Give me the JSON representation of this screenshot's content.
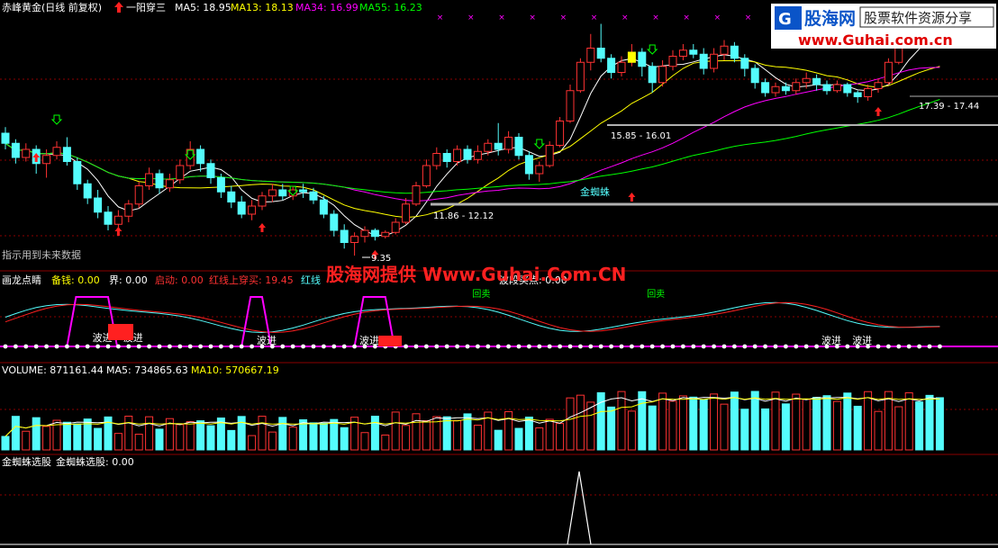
{
  "colors": {
    "background": "#000000",
    "up": "#ff3232",
    "down": "#54fcfc",
    "ma5": "#ffffff",
    "ma13": "#ffff00",
    "ma34": "#ff00ff",
    "ma55": "#00ff00",
    "grid": "#8b0000",
    "logo_blue": "#0a54c8",
    "logo_red": "#e00000",
    "watermark": "#ff2020"
  },
  "header": {
    "stock_name": "赤峰黄金(日线 前复权)",
    "pattern_name": "一阳穿三",
    "ma5_label": "MA5: 18.95",
    "ma13_label": "MA13: 18.13",
    "ma34_label": "MA34: 16.99",
    "ma55_label": "MA55: 16.23"
  },
  "logo": {
    "brand": "股海网",
    "slogan": "股票软件资源分享",
    "url": "www.Guhai.com.cn"
  },
  "main_notes": {
    "future_data_note": "指示用到未来数据",
    "low_label": "9.35",
    "range1": "11.86 - 12.12",
    "range2": "15.85 - 16.01",
    "range3": "17.39 - 17.44",
    "golden_spider": "金蜘蛛"
  },
  "panel2": {
    "title": "画龙点睛",
    "fields": [
      {
        "label": "备钱: 0.00",
        "color": "#ffff00"
      },
      {
        "label": "界: 0.00",
        "color": "#ffffff"
      },
      {
        "label": "启动: 0.00",
        "color": "#ff3232"
      },
      {
        "label": "红线上穿买: 19.45",
        "color": "#ff3232"
      },
      {
        "label": "红线",
        "color": "#54fcfc"
      }
    ],
    "trailing": "波段买点: 0.00",
    "watermark": "股海网提供 Www.Guhai.Com.CN",
    "signal_label": "波进",
    "top_label": "回卖"
  },
  "panel3": {
    "volume_label": "VOLUME: 871161.44",
    "ma5_label": "MA5: 734865.63",
    "ma10_label": "MA10: 570667.19"
  },
  "panel4": {
    "title": "金蜘蛛选股",
    "value_label": "金蜘蛛选股: 0.00"
  },
  "chart_data": {
    "type": "candlestick",
    "price_range": [
      9,
      21
    ],
    "candles": [
      {
        "o": 15.4,
        "c": 14.9,
        "h": 15.7,
        "l": 14.6
      },
      {
        "o": 14.9,
        "c": 14.2,
        "h": 15.1,
        "l": 13.9
      },
      {
        "o": 14.2,
        "c": 14.6,
        "h": 14.9,
        "l": 14.0
      },
      {
        "o": 14.6,
        "c": 13.9,
        "h": 14.8,
        "l": 13.4
      },
      {
        "o": 13.9,
        "c": 14.3,
        "h": 14.6,
        "l": 13.2
      },
      {
        "o": 14.3,
        "c": 14.7,
        "h": 15.0,
        "l": 14.1
      },
      {
        "o": 14.7,
        "c": 14.0,
        "h": 15.2,
        "l": 13.8
      },
      {
        "o": 14.0,
        "c": 12.9,
        "h": 14.2,
        "l": 12.6
      },
      {
        "o": 12.9,
        "c": 12.2,
        "h": 13.1,
        "l": 11.9
      },
      {
        "o": 12.2,
        "c": 11.5,
        "h": 12.6,
        "l": 11.2
      },
      {
        "o": 11.5,
        "c": 10.9,
        "h": 11.8,
        "l": 10.6
      },
      {
        "o": 10.9,
        "c": 11.3,
        "h": 11.6,
        "l": 10.6
      },
      {
        "o": 11.3,
        "c": 11.9,
        "h": 12.1,
        "l": 11.0
      },
      {
        "o": 11.9,
        "c": 12.8,
        "h": 13.0,
        "l": 11.7
      },
      {
        "o": 12.8,
        "c": 13.4,
        "h": 13.7,
        "l": 12.6
      },
      {
        "o": 13.4,
        "c": 12.7,
        "h": 13.6,
        "l": 12.4
      },
      {
        "o": 12.7,
        "c": 13.1,
        "h": 13.4,
        "l": 12.5
      },
      {
        "o": 13.1,
        "c": 13.8,
        "h": 14.1,
        "l": 12.9
      },
      {
        "o": 13.8,
        "c": 14.6,
        "h": 15.0,
        "l": 13.6
      },
      {
        "o": 14.6,
        "c": 13.9,
        "h": 14.8,
        "l": 13.5
      },
      {
        "o": 13.9,
        "c": 13.2,
        "h": 14.1,
        "l": 12.9
      },
      {
        "o": 13.2,
        "c": 12.5,
        "h": 13.4,
        "l": 12.2
      },
      {
        "o": 12.5,
        "c": 12.0,
        "h": 12.8,
        "l": 11.7
      },
      {
        "o": 12.0,
        "c": 11.4,
        "h": 12.3,
        "l": 11.2
      },
      {
        "o": 11.4,
        "c": 11.8,
        "h": 12.1,
        "l": 11.1
      },
      {
        "o": 11.8,
        "c": 12.3,
        "h": 12.5,
        "l": 11.6
      },
      {
        "o": 12.3,
        "c": 12.6,
        "h": 12.9,
        "l": 12.0
      },
      {
        "o": 12.6,
        "c": 12.3,
        "h": 12.9,
        "l": 12.1
      },
      {
        "o": 12.3,
        "c": 12.6,
        "h": 12.8,
        "l": 12.1
      },
      {
        "o": 12.6,
        "c": 12.5,
        "h": 12.9,
        "l": 12.2
      },
      {
        "o": 12.5,
        "c": 12.1,
        "h": 12.7,
        "l": 11.9
      },
      {
        "o": 12.1,
        "c": 11.4,
        "h": 12.3,
        "l": 11.2
      },
      {
        "o": 11.4,
        "c": 10.6,
        "h": 11.6,
        "l": 10.3
      },
      {
        "o": 10.6,
        "c": 10.0,
        "h": 10.9,
        "l": 9.7
      },
      {
        "o": 10.0,
        "c": 10.3,
        "h": 10.5,
        "l": 9.35
      },
      {
        "o": 10.3,
        "c": 10.6,
        "h": 10.8,
        "l": 10.0
      },
      {
        "o": 10.6,
        "c": 10.3,
        "h": 10.7,
        "l": 10.1
      },
      {
        "o": 10.3,
        "c": 10.5,
        "h": 10.6,
        "l": 10.2
      },
      {
        "o": 10.5,
        "c": 11.0,
        "h": 11.2,
        "l": 10.4
      },
      {
        "o": 11.0,
        "c": 11.9,
        "h": 12.2,
        "l": 10.9
      },
      {
        "o": 11.9,
        "c": 12.8,
        "h": 13.0,
        "l": 11.8
      },
      {
        "o": 12.8,
        "c": 13.8,
        "h": 14.1,
        "l": 12.7
      },
      {
        "o": 13.8,
        "c": 14.4,
        "h": 14.7,
        "l": 13.6
      },
      {
        "o": 14.4,
        "c": 14.0,
        "h": 14.6,
        "l": 13.7
      },
      {
        "o": 14.0,
        "c": 14.6,
        "h": 14.8,
        "l": 13.8
      },
      {
        "o": 14.6,
        "c": 14.1,
        "h": 14.8,
        "l": 13.9
      },
      {
        "o": 14.1,
        "c": 14.5,
        "h": 14.8,
        "l": 13.9
      },
      {
        "o": 14.5,
        "c": 14.9,
        "h": 15.1,
        "l": 14.3
      },
      {
        "o": 14.9,
        "c": 14.6,
        "h": 15.9,
        "l": 14.3
      },
      {
        "o": 14.6,
        "c": 15.2,
        "h": 15.5,
        "l": 14.4
      },
      {
        "o": 15.2,
        "c": 14.3,
        "h": 15.4,
        "l": 14.1
      },
      {
        "o": 14.3,
        "c": 13.4,
        "h": 14.5,
        "l": 13.1
      },
      {
        "o": 13.4,
        "c": 13.8,
        "h": 14.0,
        "l": 13.0
      },
      {
        "o": 13.8,
        "c": 14.8,
        "h": 15.0,
        "l": 13.7
      },
      {
        "o": 14.8,
        "c": 16.0,
        "h": 16.2,
        "l": 14.7
      },
      {
        "o": 16.0,
        "c": 17.5,
        "h": 17.8,
        "l": 15.9
      },
      {
        "o": 17.5,
        "c": 18.9,
        "h": 19.1,
        "l": 17.4
      },
      {
        "o": 18.9,
        "c": 19.6,
        "h": 20.3,
        "l": 18.5
      },
      {
        "o": 19.6,
        "c": 19.1,
        "h": 20.8,
        "l": 18.9
      },
      {
        "o": 19.1,
        "c": 18.4,
        "h": 19.3,
        "l": 18.1
      },
      {
        "o": 18.4,
        "c": 18.9,
        "h": 19.2,
        "l": 18.2
      },
      {
        "o": 18.9,
        "c": 19.4,
        "h": 19.8,
        "l": 18.7
      },
      {
        "o": 19.4,
        "c": 18.7,
        "h": 19.6,
        "l": 18.2
      },
      {
        "o": 18.7,
        "c": 17.9,
        "h": 18.9,
        "l": 17.4
      },
      {
        "o": 17.9,
        "c": 18.7,
        "h": 19.0,
        "l": 17.7
      },
      {
        "o": 18.7,
        "c": 19.2,
        "h": 19.5,
        "l": 18.5
      },
      {
        "o": 19.2,
        "c": 19.5,
        "h": 19.8,
        "l": 19.0
      },
      {
        "o": 19.5,
        "c": 19.3,
        "h": 19.8,
        "l": 19.1
      },
      {
        "o": 19.3,
        "c": 18.6,
        "h": 19.6,
        "l": 18.3
      },
      {
        "o": 18.6,
        "c": 19.3,
        "h": 19.6,
        "l": 18.4
      },
      {
        "o": 19.3,
        "c": 19.7,
        "h": 20.0,
        "l": 19.0
      },
      {
        "o": 19.7,
        "c": 19.1,
        "h": 19.9,
        "l": 18.9
      },
      {
        "o": 19.1,
        "c": 18.6,
        "h": 19.3,
        "l": 18.2
      },
      {
        "o": 18.6,
        "c": 17.9,
        "h": 18.8,
        "l": 17.6
      },
      {
        "o": 17.9,
        "c": 17.4,
        "h": 18.1,
        "l": 17.2
      },
      {
        "o": 17.4,
        "c": 17.7,
        "h": 17.9,
        "l": 17.2
      },
      {
        "o": 17.7,
        "c": 17.5,
        "h": 17.9,
        "l": 17.3
      },
      {
        "o": 17.5,
        "c": 17.9,
        "h": 18.1,
        "l": 17.3
      },
      {
        "o": 17.9,
        "c": 18.1,
        "h": 18.4,
        "l": 17.6
      },
      {
        "o": 18.1,
        "c": 17.8,
        "h": 18.3,
        "l": 17.5
      },
      {
        "o": 17.8,
        "c": 17.5,
        "h": 18.0,
        "l": 17.3
      },
      {
        "o": 17.5,
        "c": 17.8,
        "h": 18.0,
        "l": 17.4
      },
      {
        "o": 17.8,
        "c": 17.4,
        "h": 17.9,
        "l": 17.2
      },
      {
        "o": 17.4,
        "c": 17.2,
        "h": 17.5,
        "l": 16.9
      },
      {
        "o": 17.2,
        "c": 17.6,
        "h": 17.8,
        "l": 17.0
      },
      {
        "o": 17.6,
        "c": 17.9,
        "h": 18.1,
        "l": 17.4
      },
      {
        "o": 17.9,
        "c": 18.9,
        "h": 19.1,
        "l": 17.8
      },
      {
        "o": 18.9,
        "c": 20.1,
        "h": 20.4,
        "l": 18.8
      },
      {
        "o": 20.1,
        "c": 20.6,
        "h": 21.0,
        "l": 19.9
      },
      {
        "o": 20.6,
        "c": 20.3,
        "h": 21.0,
        "l": 20.1
      },
      {
        "o": 20.3,
        "c": 20.1,
        "h": 20.5,
        "l": 19.9
      },
      {
        "o": 20.1,
        "c": 19.9,
        "h": 20.3,
        "l": 19.6
      }
    ],
    "volume_range": [
      0,
      1600000
    ],
    "golden_spider_signal_index": 61
  }
}
